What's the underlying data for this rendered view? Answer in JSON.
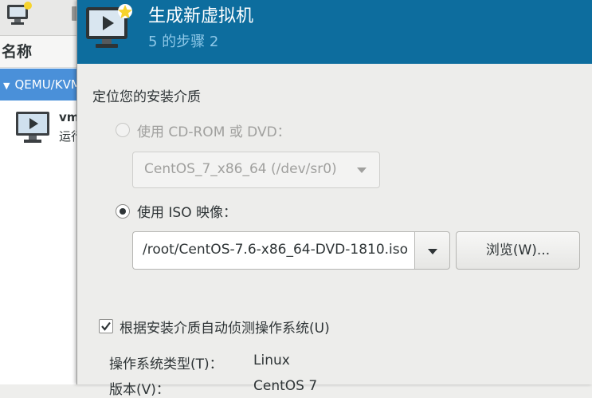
{
  "manager": {
    "column_header": "名称",
    "connection": "QEMU/KVM",
    "vm": {
      "name": "vm",
      "state": "运行"
    }
  },
  "dialog": {
    "title": "生成新虚拟机",
    "step": "5 的步骤 2",
    "section_title": "定位您的安装介质",
    "cdrom_option": {
      "label": "使用 CD-ROM 或 DVD：",
      "selected": false,
      "enabled": false
    },
    "cdrom_select": {
      "value": "CentOS_7_x86_64 (/dev/sr0)"
    },
    "iso_option": {
      "label": "使用 ISO 映像：",
      "selected": true
    },
    "iso_path": "/root/CentOS-7.6-x86_64-DVD-1810.iso",
    "browse_button": "浏览(W)...",
    "auto_detect": {
      "label": "根据安装介质自动侦测操作系统(U)",
      "checked": true
    },
    "os_type": {
      "label": "操作系统类型(T)：",
      "value": "Linux"
    },
    "version": {
      "label": "版本(V)：",
      "value": "CentOS 7"
    }
  },
  "colors": {
    "banner": "#0d6d9e",
    "selection": "#4a90d9"
  }
}
